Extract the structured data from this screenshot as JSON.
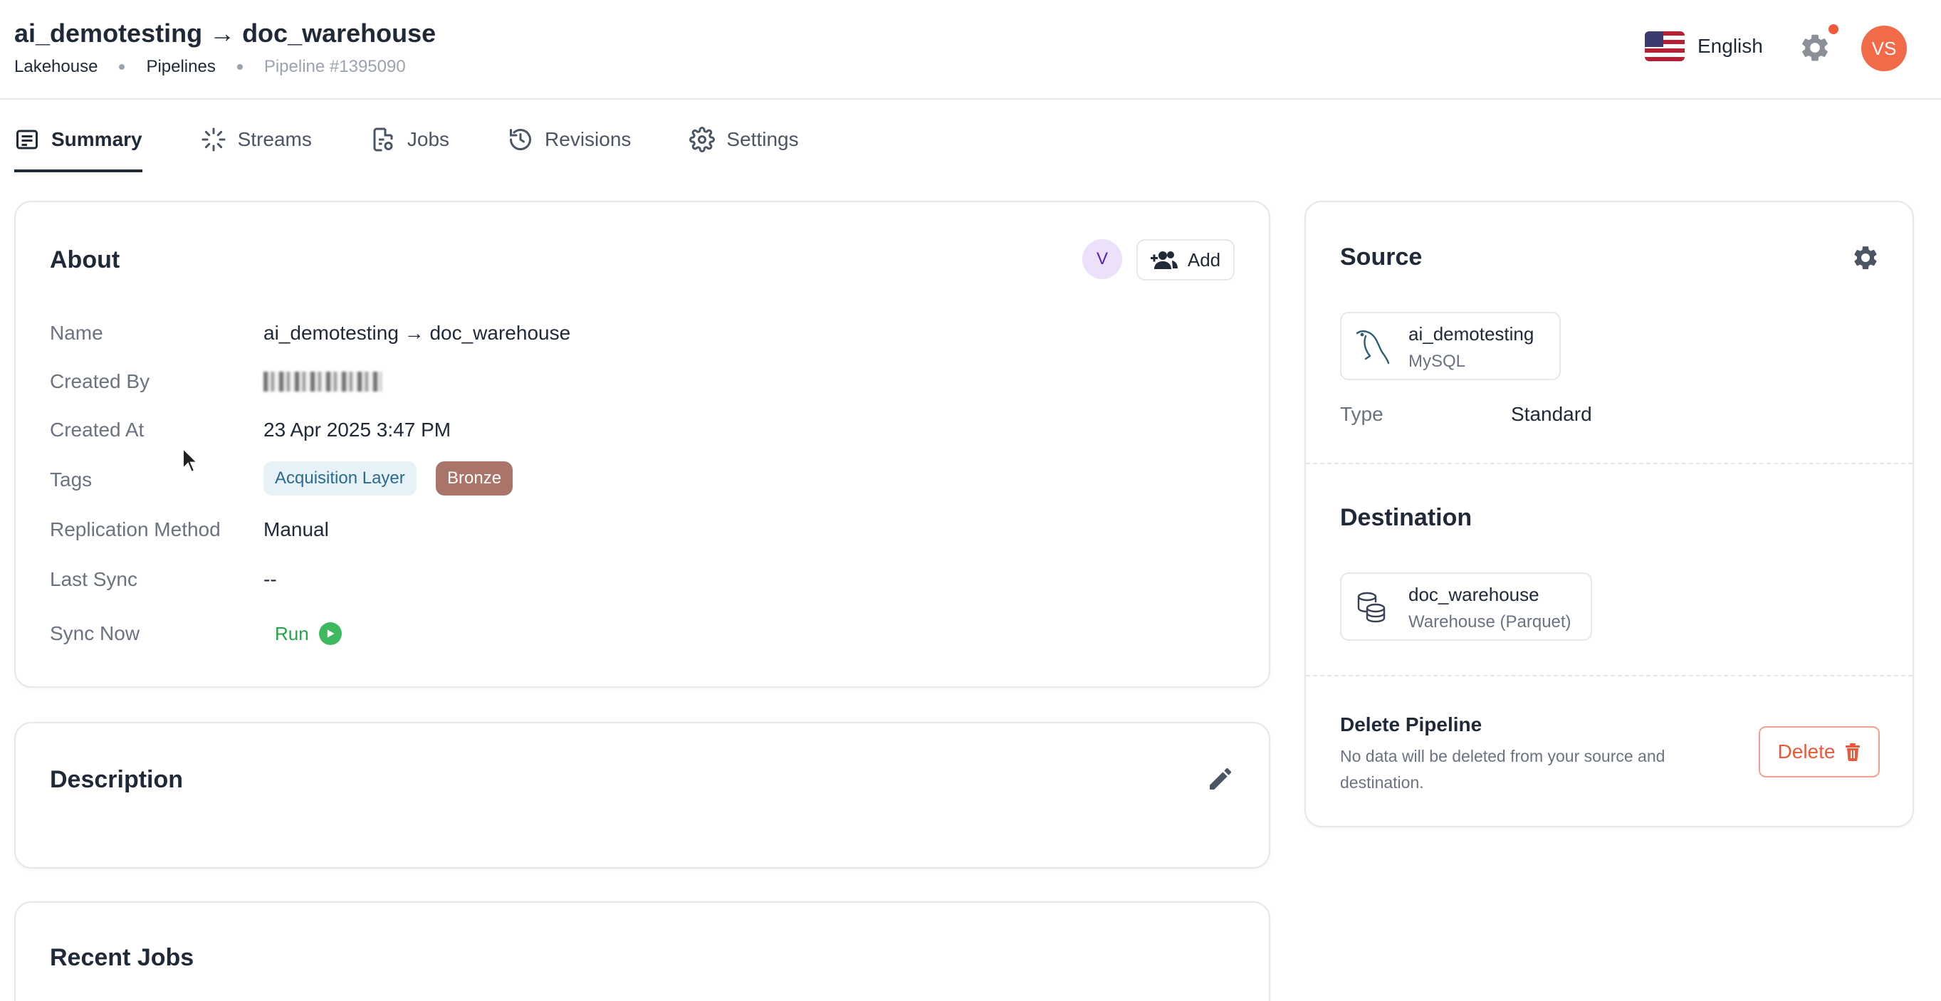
{
  "header": {
    "title": "ai_demotesting → doc_warehouse",
    "breadcrumb": [
      "Lakehouse",
      "Pipelines",
      "Pipeline #1395090"
    ],
    "language": "English",
    "user_initials": "VS"
  },
  "tabs": [
    {
      "label": "Summary",
      "icon": "summary-icon",
      "active": true
    },
    {
      "label": "Streams",
      "icon": "streams-icon",
      "active": false
    },
    {
      "label": "Jobs",
      "icon": "jobs-icon",
      "active": false
    },
    {
      "label": "Revisions",
      "icon": "history-icon",
      "active": false
    },
    {
      "label": "Settings",
      "icon": "gear-icon",
      "active": false
    }
  ],
  "about": {
    "title": "About",
    "collaborator_initial": "V",
    "add_label": "Add",
    "rows": {
      "name_label": "Name",
      "name_value": "ai_demotesting → doc_warehouse",
      "created_by_label": "Created By",
      "created_at_label": "Created At",
      "created_at_value": "23 Apr 2025 3:47 PM",
      "tags_label": "Tags",
      "replication_label": "Replication Method",
      "replication_value": "Manual",
      "last_sync_label": "Last Sync",
      "last_sync_value": "--",
      "sync_now_label": "Sync Now",
      "run_label": "Run"
    },
    "tags": [
      "Acquisition Layer",
      "Bronze"
    ]
  },
  "description": {
    "title": "Description"
  },
  "recent_jobs": {
    "title": "Recent Jobs"
  },
  "source": {
    "title": "Source",
    "connector_name": "ai_demotesting",
    "connector_type": "MySQL",
    "type_label": "Type",
    "type_value": "Standard"
  },
  "destination": {
    "title": "Destination",
    "connector_name": "doc_warehouse",
    "connector_type": "Warehouse (Parquet)"
  },
  "delete": {
    "title": "Delete Pipeline",
    "description": "No data will be deleted from your source and destination.",
    "button_label": "Delete"
  },
  "colors": {
    "accent": "#f26a47",
    "run_green": "#22a447",
    "tag_acquisition_bg": "#e6f2f8",
    "tag_bronze_bg": "#a97469"
  }
}
